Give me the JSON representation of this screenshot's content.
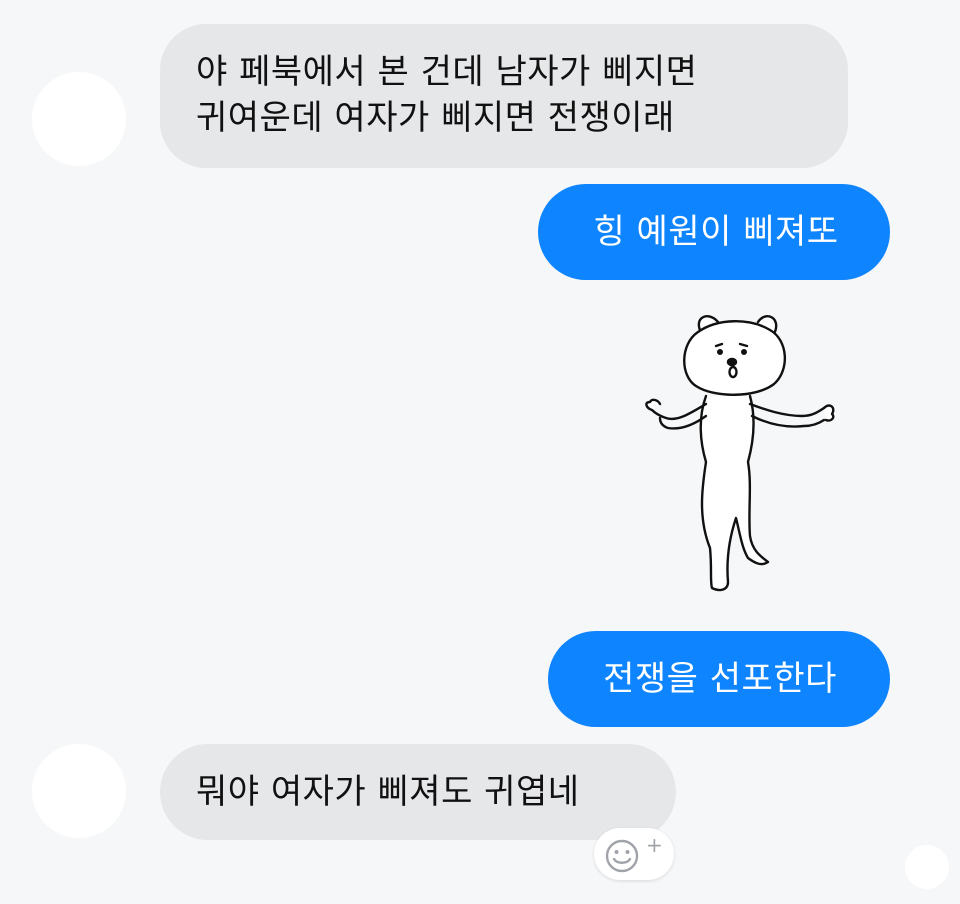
{
  "conversation": {
    "messages": [
      {
        "direction": "incoming",
        "text": "야 페북에서 본 건데 남자가 삐지면\n귀여운데 여자가 삐지면 전쟁이래"
      },
      {
        "direction": "outgoing",
        "text": "힝 예원이 삐져또"
      },
      {
        "direction": "outgoing",
        "sticker": "bear-shrugging-sticker"
      },
      {
        "direction": "outgoing",
        "text": "전쟁을 선포한다"
      },
      {
        "direction": "incoming",
        "text": "뭐야 여자가 삐져도 귀엽네"
      }
    ]
  },
  "reaction": {
    "icon": "smiley-add-reaction-icon",
    "symbol": "+"
  },
  "colors": {
    "background": "#f6f7f8",
    "incoming_bubble": "#e6e7e9",
    "outgoing_bubble": "#0f84ff",
    "outgoing_text": "#ffffff",
    "incoming_text": "#111111"
  }
}
